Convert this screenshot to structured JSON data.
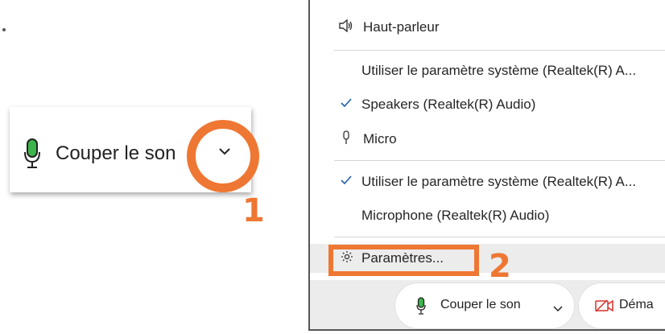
{
  "mute_control": {
    "label": "Couper le son",
    "icon": "microphone-icon",
    "dropdown_icon": "chevron-down-icon"
  },
  "annotations": {
    "step1": "1",
    "step2": "2",
    "color": "#ee7733"
  },
  "menu": {
    "speaker_header": "Haut-parleur",
    "speaker_options": [
      {
        "label": "Utiliser le paramètre système (Realtek(R) A...",
        "checked": false
      },
      {
        "label": "Speakers (Realtek(R) Audio)",
        "checked": true
      }
    ],
    "mic_header": "Micro",
    "mic_options": [
      {
        "label": "Utiliser le paramètre système (Realtek(R) A...",
        "checked": true
      },
      {
        "label": "Microphone (Realtek(R) Audio)",
        "checked": false
      }
    ],
    "settings_label": "Paramètres..."
  },
  "toolbar": {
    "mute_label": "Couper le son",
    "video_label": "Déma"
  },
  "colors": {
    "mic_green": "#3cb54a",
    "video_red": "#d9302c",
    "check_blue": "#1f5fa8"
  }
}
